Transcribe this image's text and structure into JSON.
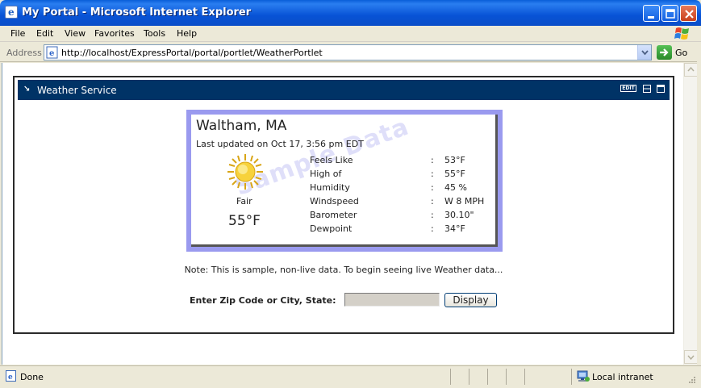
{
  "window": {
    "title": "My Portal - Microsoft Internet Explorer"
  },
  "menu": [
    "File",
    "Edit",
    "View",
    "Favorites",
    "Tools",
    "Help"
  ],
  "address": {
    "label": "Address",
    "url": "http://localhost/ExpressPortal/portal/portlet/WeatherPortlet",
    "go_label": "Go"
  },
  "portlet": {
    "title": "Weather Service",
    "edit_label": "EDIT"
  },
  "weather": {
    "city": "Waltham, MA",
    "updated": "Last updated on Oct 17, 3:56 pm EDT",
    "condition": "Fair",
    "temperature": "55°F",
    "watermark": "Sample Data",
    "stats": [
      {
        "label": "Feels Like",
        "sep": ":",
        "value": "53°F"
      },
      {
        "label": "High of",
        "sep": ":",
        "value": "55°F"
      },
      {
        "label": "Humidity",
        "sep": ":",
        "value": "45 %"
      },
      {
        "label": "Windspeed",
        "sep": ":",
        "value": "W 8 MPH"
      },
      {
        "label": "Barometer",
        "sep": ":",
        "value": "30.10\""
      },
      {
        "label": "Dewpoint",
        "sep": ":",
        "value": "34°F"
      }
    ]
  },
  "note": "Note: This is sample, non-live data. To begin seeing live Weather data...",
  "form": {
    "zip_label": "Enter Zip Code or City, State:",
    "zip_value": "",
    "display_label": "Display"
  },
  "status": {
    "text": "Done",
    "zone": "Local intranet"
  },
  "colors": {
    "title_bar": "#0853d6",
    "portlet_header": "#003366",
    "card_border": "#9a9aef"
  }
}
